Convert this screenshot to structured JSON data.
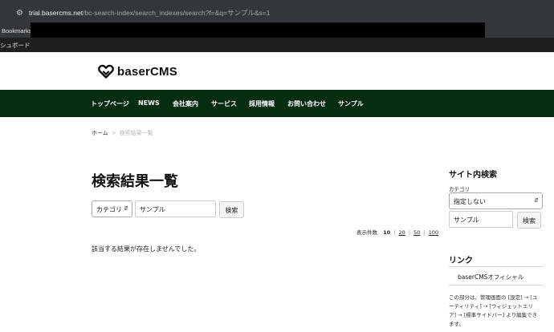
{
  "browser": {
    "url_host": "trial.basercms.net",
    "url_path": "/bc-search-index/search_indexes/search?f=&q=サンプル&s=1",
    "bookmarks_label": "Bookmarks"
  },
  "admin_bar": {
    "label": "シュボード"
  },
  "site": {
    "logo_text": "baserCMS"
  },
  "nav": {
    "items": [
      "トップページ",
      "NEWS",
      "会社案内",
      "サービス",
      "採用情報",
      "お問い合わせ",
      "サンプル"
    ]
  },
  "breadcrumb": {
    "home": "ホーム",
    "separator": ">",
    "current": "検索結果一覧"
  },
  "main": {
    "title": "検索結果一覧",
    "search_form": {
      "category_value": "カテゴリ",
      "keyword_value": "サンプル",
      "submit_label": "検索"
    },
    "limit": {
      "label": "表示件数",
      "options": [
        "10",
        "20",
        "50",
        "100"
      ],
      "selected": "10"
    },
    "no_results_text": "該当する結果が存在しませんでした。"
  },
  "sidebar": {
    "search_heading": "サイト内検索",
    "category_label": "カテゴリ",
    "category_select_value": "指定しない",
    "keyword_value": "サンプル",
    "submit_label": "検索",
    "links_heading": "リンク",
    "links": [
      "baserCMSオフィシャル"
    ],
    "note_lines": [
      "この部分は、管理画面の [設定] → [ユ",
      "ーティリティ] → [ウィジェットエリ",
      "ア] → [標準サイドバー] より編集でき",
      "ます。"
    ]
  },
  "colors": {
    "nav_background": "#072d11",
    "browser_chrome": "#35363a"
  }
}
